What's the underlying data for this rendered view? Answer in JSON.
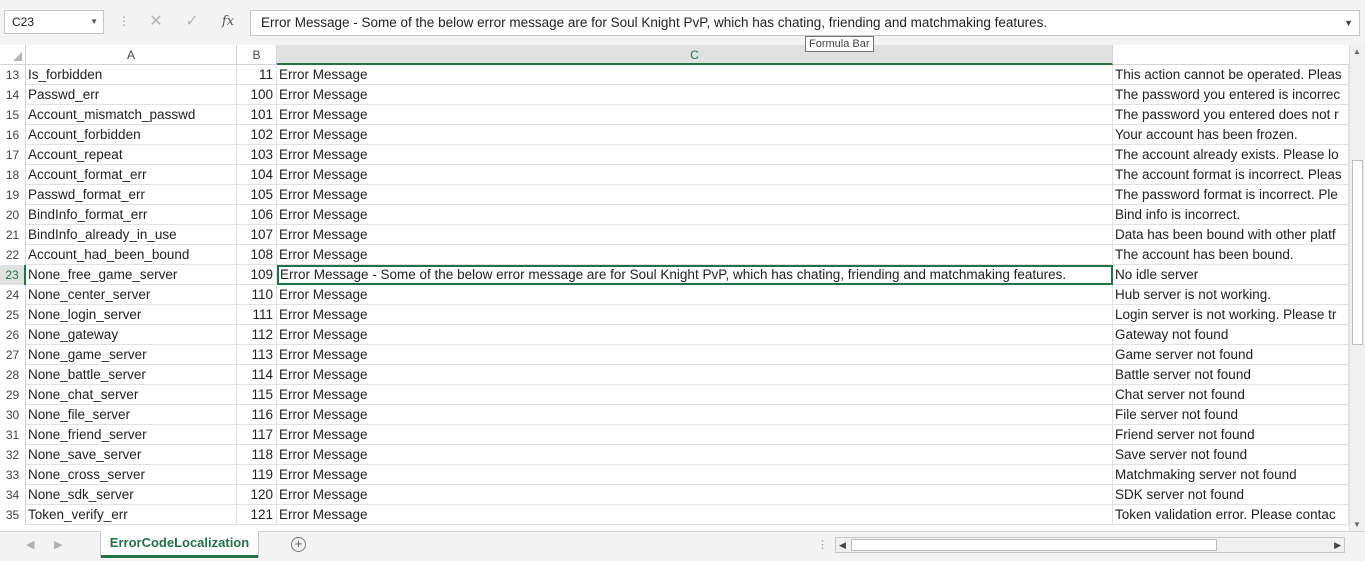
{
  "formula_bar": {
    "name_box": "C23",
    "content": "Error Message - Some of the below error message are for Soul Knight PvP, which has chating, friending and matchmaking features.",
    "tooltip": "Formula Bar",
    "cancel_icon": "✕",
    "enter_icon": "✓",
    "fx_label": "fx"
  },
  "columns": [
    "A",
    "B",
    "C"
  ],
  "rows": [
    {
      "n": "13",
      "a": "Is_forbidden",
      "b": "11",
      "c": "Error Message",
      "d": "This action cannot be operated. Pleas"
    },
    {
      "n": "14",
      "a": "Passwd_err",
      "b": "100",
      "c": "Error Message",
      "d": "The password you entered is incorrec"
    },
    {
      "n": "15",
      "a": "Account_mismatch_passwd",
      "b": "101",
      "c": "Error Message",
      "d": "The password you entered does not r"
    },
    {
      "n": "16",
      "a": "Account_forbidden",
      "b": "102",
      "c": "Error Message",
      "d": "Your account has been frozen."
    },
    {
      "n": "17",
      "a": "Account_repeat",
      "b": "103",
      "c": "Error Message",
      "d": "The account already exists. Please lo"
    },
    {
      "n": "18",
      "a": "Account_format_err",
      "b": "104",
      "c": "Error Message",
      "d": "The account format is incorrect. Pleas"
    },
    {
      "n": "19",
      "a": "Passwd_format_err",
      "b": "105",
      "c": "Error Message",
      "d": "The password format is incorrect. Ple"
    },
    {
      "n": "20",
      "a": "BindInfo_format_err",
      "b": "106",
      "c": "Error Message",
      "d": "Bind info is incorrect."
    },
    {
      "n": "21",
      "a": "BindInfo_already_in_use",
      "b": "107",
      "c": "Error Message",
      "d": "Data has been bound with other platf"
    },
    {
      "n": "22",
      "a": "Account_had_been_bound",
      "b": "108",
      "c": "Error Message",
      "d": "The account has been bound."
    },
    {
      "n": "23",
      "a": "None_free_game_server",
      "b": "109",
      "c": "Error Message - Some of the below error message are for Soul Knight PvP, which has chating, friending and matchmaking features.",
      "d": "No idle server"
    },
    {
      "n": "24",
      "a": "None_center_server",
      "b": "110",
      "c": "Error Message",
      "d": "Hub server is not working."
    },
    {
      "n": "25",
      "a": "None_login_server",
      "b": "111",
      "c": "Error Message",
      "d": "Login server is not working. Please tr"
    },
    {
      "n": "26",
      "a": "None_gateway",
      "b": "112",
      "c": "Error Message",
      "d": "Gateway not found"
    },
    {
      "n": "27",
      "a": "None_game_server",
      "b": "113",
      "c": "Error Message",
      "d": "Game server not found"
    },
    {
      "n": "28",
      "a": "None_battle_server",
      "b": "114",
      "c": "Error Message",
      "d": "Battle server not found"
    },
    {
      "n": "29",
      "a": "None_chat_server",
      "b": "115",
      "c": "Error Message",
      "d": "Chat server not found"
    },
    {
      "n": "30",
      "a": "None_file_server",
      "b": "116",
      "c": "Error Message",
      "d": "File server not found"
    },
    {
      "n": "31",
      "a": "None_friend_server",
      "b": "117",
      "c": "Error Message",
      "d": "Friend server not found"
    },
    {
      "n": "32",
      "a": "None_save_server",
      "b": "118",
      "c": "Error Message",
      "d": "Save server not found"
    },
    {
      "n": "33",
      "a": "None_cross_server",
      "b": "119",
      "c": "Error Message",
      "d": "Matchmaking server not found"
    },
    {
      "n": "34",
      "a": "None_sdk_server",
      "b": "120",
      "c": "Error Message",
      "d": "SDK server not found"
    },
    {
      "n": "35",
      "a": "Token_verify_err",
      "b": "121",
      "c": "Error Message",
      "d": "Token validation error. Please contac"
    }
  ],
  "selected_row": "23",
  "sheet_tab": "ErrorCodeLocalization",
  "add_sheet": "+",
  "accent_color": "#217346"
}
